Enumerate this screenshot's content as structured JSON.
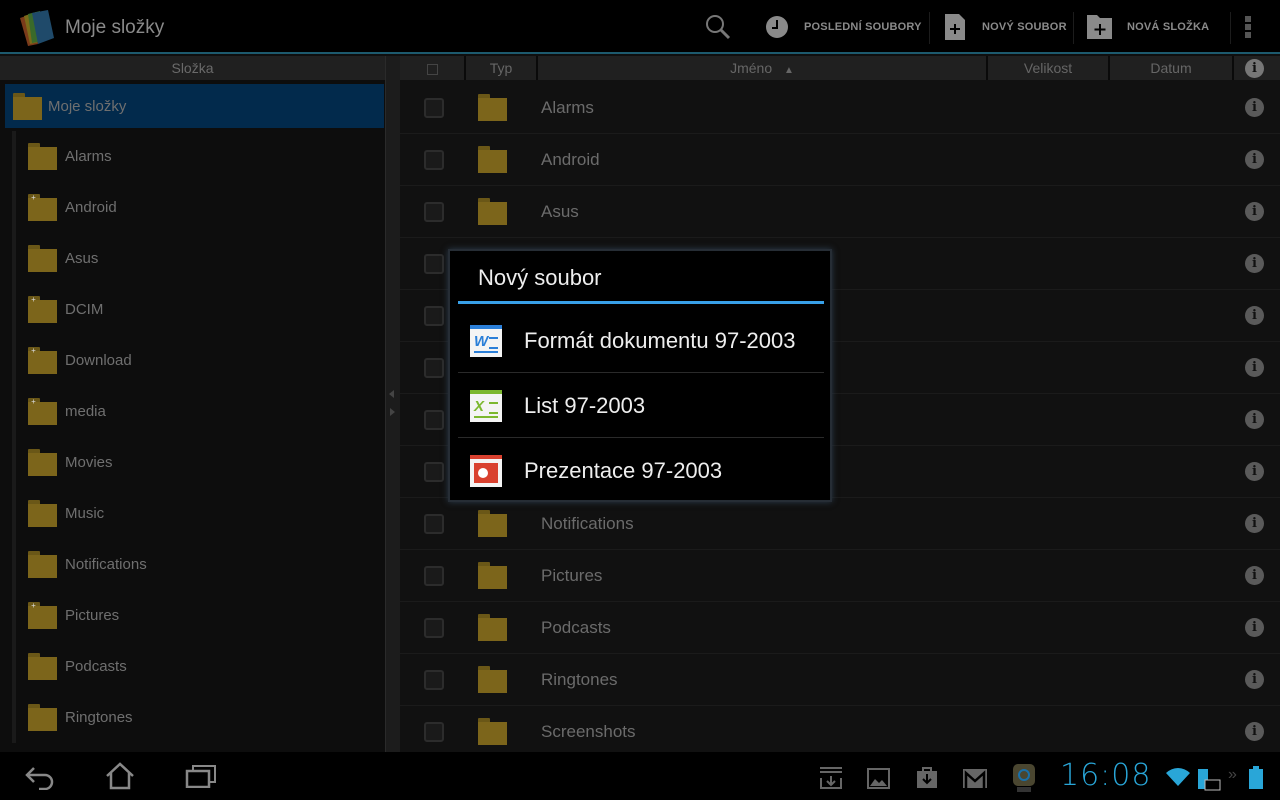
{
  "app": {
    "title": "Moje složky"
  },
  "toolbar": {
    "search_icon": "search-icon",
    "recent_label": "POSLEDNÍ SOUBORY",
    "new_file_label": "NOVÝ SOUBOR",
    "new_folder_label": "NOVÁ SLOŽKA"
  },
  "sidebar": {
    "header": "Složka",
    "root": "Moje složky",
    "items": [
      {
        "label": "Alarms",
        "has_sub": false
      },
      {
        "label": "Android",
        "has_sub": true
      },
      {
        "label": "Asus",
        "has_sub": false
      },
      {
        "label": "DCIM",
        "has_sub": true
      },
      {
        "label": "Download",
        "has_sub": true
      },
      {
        "label": "media",
        "has_sub": true
      },
      {
        "label": "Movies",
        "has_sub": false
      },
      {
        "label": "Music",
        "has_sub": false
      },
      {
        "label": "Notifications",
        "has_sub": false
      },
      {
        "label": "Pictures",
        "has_sub": true
      },
      {
        "label": "Podcasts",
        "has_sub": false
      },
      {
        "label": "Ringtones",
        "has_sub": false
      }
    ]
  },
  "main": {
    "columns": {
      "type": "Typ",
      "name": "Jméno",
      "size": "Velikost",
      "date": "Datum"
    },
    "sort": "name-ascending",
    "rows": [
      "Alarms",
      "Android",
      "Asus",
      "",
      "",
      "",
      "",
      "",
      "Notifications",
      "Pictures",
      "Podcasts",
      "Ringtones",
      "Screenshots"
    ]
  },
  "dialog": {
    "title": "Nový soubor",
    "accent": "#38a0e8",
    "options": [
      {
        "label": "Formát dokumentu 97-2003",
        "icon": "word-doc-icon",
        "color": "#2b7fd8",
        "glyph": "W"
      },
      {
        "label": "List 97-2003",
        "icon": "excel-sheet-icon",
        "color": "#7cb82f",
        "glyph": "X"
      },
      {
        "label": "Prezentace 97-2003",
        "icon": "powerpoint-icon",
        "color": "#d9412f",
        "glyph": ""
      }
    ]
  },
  "status": {
    "time": "16:08",
    "clock_color": "#29a6d8"
  }
}
